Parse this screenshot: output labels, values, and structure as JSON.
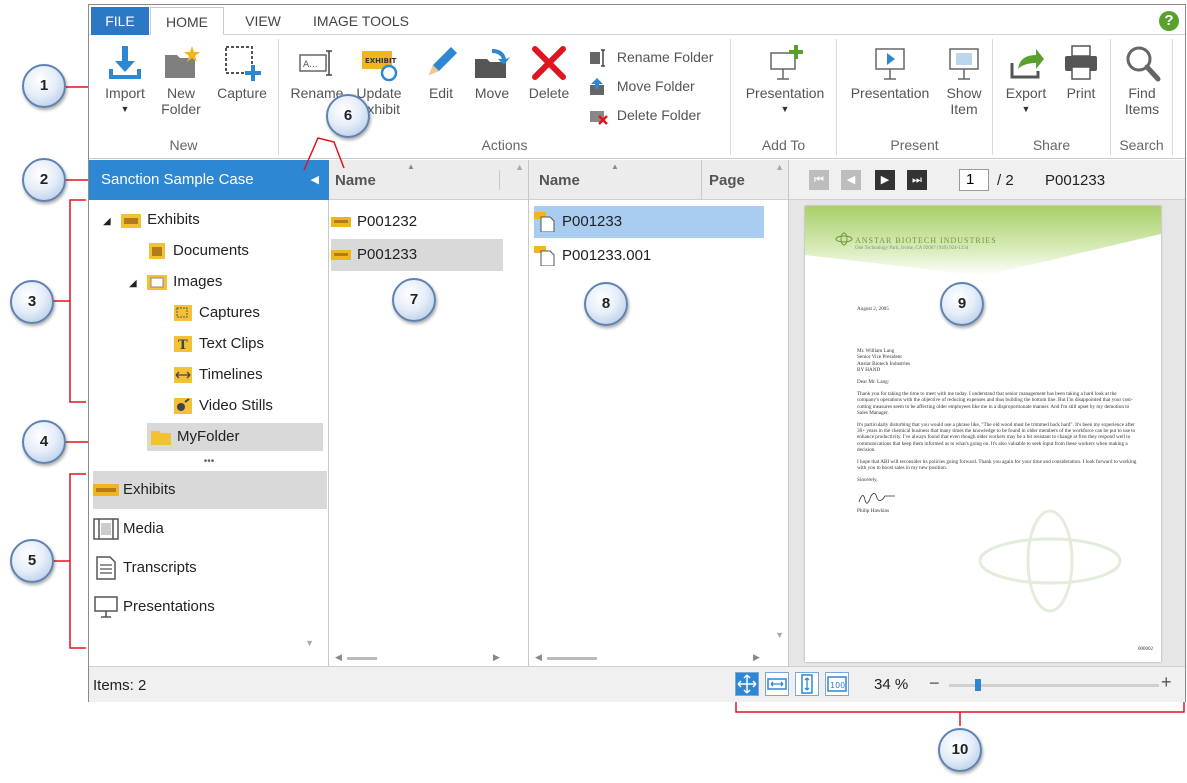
{
  "tabs": {
    "file": "FILE",
    "home": "HOME",
    "view": "VIEW",
    "tools": "IMAGE TOOLS",
    "help": "?"
  },
  "ribbon": {
    "new": {
      "label": "New",
      "import": "Import",
      "new_folder_1": "New",
      "new_folder_2": "Folder",
      "capture": "Capture"
    },
    "actions": {
      "label": "Actions",
      "rename": "Rename",
      "update_1": "Update",
      "update_2": "Exhibit",
      "edit": "Edit",
      "move": "Move",
      "delete": "Delete",
      "rename_folder": "Rename Folder",
      "move_folder": "Move Folder",
      "delete_folder": "Delete Folder",
      "exhibit_badge": "EXHIBIT"
    },
    "add_to": {
      "label": "Add To",
      "presentation": "Presentation"
    },
    "present": {
      "label": "Present",
      "presentation": "Presentation",
      "show_item_1": "Show",
      "show_item_2": "Item"
    },
    "share": {
      "label": "Share",
      "export": "Export",
      "print": "Print"
    },
    "search": {
      "label": "Search",
      "find_1": "Find",
      "find_2": "Items"
    }
  },
  "left": {
    "case": "Sanction Sample Case",
    "tree": [
      "Exhibits",
      "Documents",
      "Images",
      "Captures",
      "Text Clips",
      "Timelines",
      "Video Stills",
      "MyFolder"
    ],
    "splitter": "•••",
    "nav": [
      "Exhibits",
      "Media",
      "Transcripts",
      "Presentations"
    ]
  },
  "col1": {
    "header": "Name",
    "rows": [
      "P001232",
      "P001233"
    ]
  },
  "col2": {
    "header_name": "Name",
    "header_page": "Page",
    "rows": [
      "P001233",
      "P001233.001"
    ]
  },
  "viewer": {
    "page_current": "1",
    "page_total": "/ 2",
    "doc_id": "P001233",
    "company": "ANSTAR BIOTECH INDUSTRIES",
    "company_sub": "One Technology Park, Irvine, CA 92607  (949) 924-1234",
    "date": "August 2, 2005",
    "addr": [
      "Mr. William Lang",
      "Senior Vice President",
      "Anstar Biotech Industries",
      "BY HAND"
    ],
    "salutation": "Dear Mr. Lang:",
    "p1": "Thank you for taking the time to meet with me today. I understand that senior management has been taking a hard look at the company's operations with the objective of reducing expenses and thus building the bottom line. But I'm disappointed that your cost-cutting measures seem to be affecting older employees like me in a disproportionate manner. And I'm still upset by my demotion to Sales Manager.",
    "p2": "It's particularly disturbing that you would use a phrase like, \"The old wood must be trimmed back hard\". It's been my experience after 30+ years in the chemical business that many times the knowledge to be found in older members of the workforce can be put to use to enhance productivity. I've always found that even though older workers may be a bit resistant to change at first they respond well to communications that keep them informed as to what's going on. It's also valuable to seek input from these workers when making a decision.",
    "p3": "I hope that ABI will reconsider its policies going forward. Thank you again for your time and consideration. I look forward to working with you to boost sales in my new position.",
    "closing": "Sincerely,",
    "signer": "Philip Hawkins",
    "page_num": "000002"
  },
  "status": {
    "items": "Items: 2",
    "zoom": "34 %",
    "zoom_minus": "−",
    "zoom_plus": "+",
    "zoom_fraction": 0.14,
    "fit_100": "100"
  },
  "callouts": [
    "1",
    "2",
    "3",
    "4",
    "5",
    "6",
    "7",
    "8",
    "9",
    "10"
  ],
  "colors": {
    "accent": "#2e87d3",
    "callout_line": "#e0141e",
    "selection": "#d9d9d9",
    "selection_blue": "#a9cdf0"
  }
}
